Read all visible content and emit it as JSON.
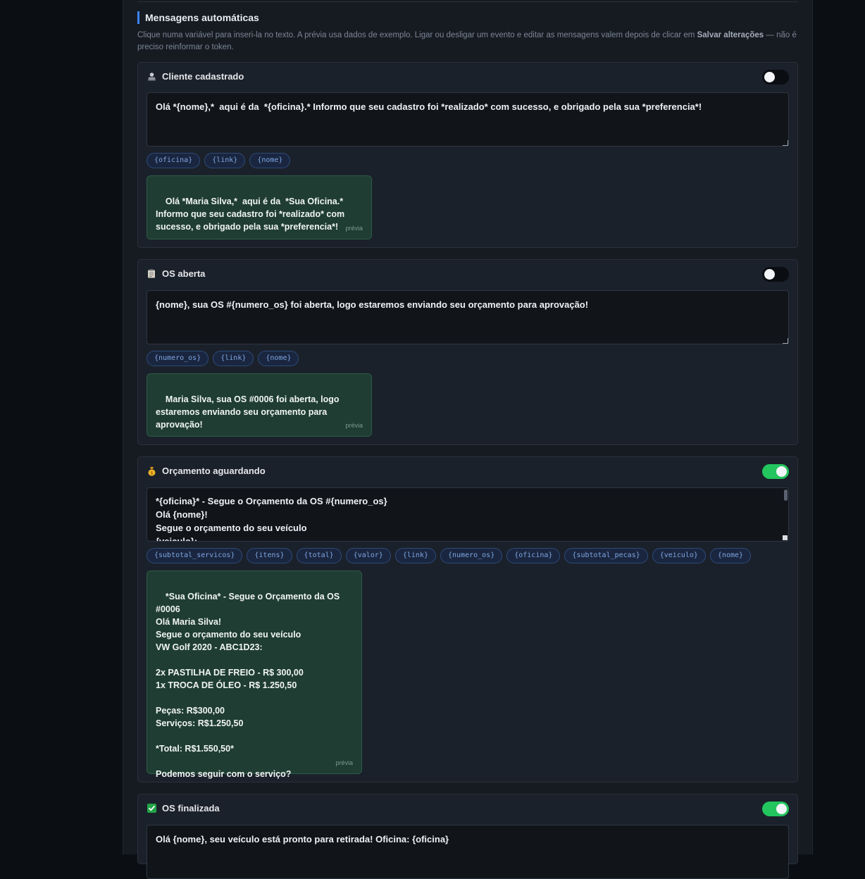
{
  "section": {
    "title": "Mensagens automáticas",
    "desc_part1": "Clique numa variável para inseri-la no texto. A prévia usa dados de exemplo. Ligar ou desligar um evento e editar as mensagens valem depois de clicar em ",
    "desc_bold": "Salvar alterações",
    "desc_part2": " — não é preciso reinformar o token."
  },
  "preview_label": "prévia",
  "cards": [
    {
      "icon": "user-silhouette-icon",
      "title": "Cliente cadastrado",
      "enabled": false,
      "message": "Olá *{nome},*  aqui é da  *{oficina}.* Informo que seu cadastro foi *realizado* com sucesso, e obrigado pela sua *preferencia*!",
      "variables": [
        "{oficina}",
        "{link}",
        "{nome}"
      ],
      "preview": "Olá *Maria Silva,*  aqui é da  *Sua Oficina.* Informo que seu cadastro foi *realizado* com sucesso, e obrigado pela sua *preferencia*!"
    },
    {
      "icon": "clipboard-icon",
      "title": "OS aberta",
      "enabled": false,
      "message": "{nome}, sua OS #{numero_os} foi aberta, logo estaremos enviando seu orçamento para aprovação!",
      "variables": [
        "{numero_os}",
        "{link}",
        "{nome}"
      ],
      "preview": "Maria Silva, sua OS #0006 foi aberta, logo estaremos enviando seu orçamento para aprovação!"
    },
    {
      "icon": "money-bag-icon",
      "title": "Orçamento aguardando",
      "enabled": true,
      "message": "*{oficina}* - Segue o Orçamento da OS #{numero_os}\nOlá {nome}!\nSegue o orçamento do seu veículo\n{veiculo}:",
      "variables": [
        "{subtotal_servicos}",
        "{itens}",
        "{total}",
        "{valor}",
        "{link}",
        "{numero_os}",
        "{oficina}",
        "{subtotal_pecas}",
        "{veiculo}",
        "{nome}"
      ],
      "preview": "*Sua Oficina* - Segue o Orçamento da OS #0006\nOlá Maria Silva!\nSegue o orçamento do seu veículo\nVW Golf 2020 - ABC1D23:\n\n2x PASTILHA DE FREIO - R$ 300,00\n1x TROCA DE ÓLEO - R$ 1.250,50\n\nPeças: R$300,00\nServiços: R$1.250,50\n\n*Total: R$1.550,50*\n\nPodemos seguir com o serviço?"
    },
    {
      "icon": "check-mark-icon",
      "title": "OS finalizada",
      "enabled": true,
      "message": "Olá {nome}, seu veículo está pronto para retirada! Oficina: {oficina}"
    }
  ],
  "colors": {
    "accent": "#3b82f6",
    "toggle_on": "#22c55e",
    "preview_bg": "#1f3d33",
    "chip_text": "#7ea6e0"
  }
}
